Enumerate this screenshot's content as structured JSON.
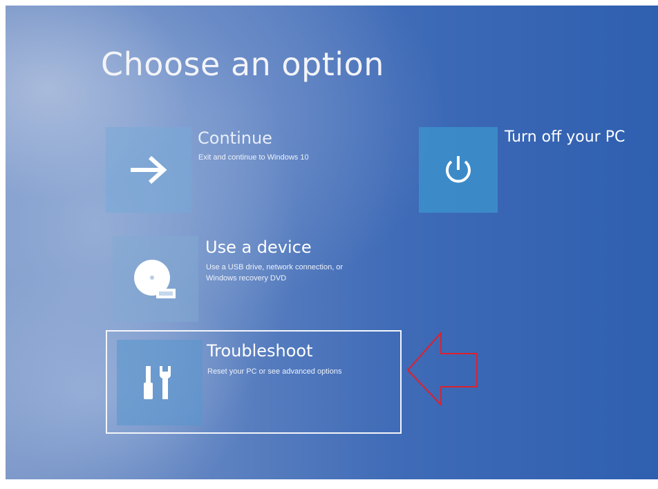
{
  "screen": {
    "title": "Choose an option"
  },
  "options": [
    {
      "id": "continue",
      "title": "Continue",
      "description": "Exit and continue to Windows 10",
      "icon": "arrow-right-icon"
    },
    {
      "id": "use-device",
      "title": "Use a device",
      "description": "Use a USB drive, network connection, or Windows recovery DVD",
      "icon": "disc-drive-icon"
    },
    {
      "id": "troubleshoot",
      "title": "Troubleshoot",
      "description": "Reset your PC or see advanced options",
      "icon": "tools-icon",
      "highlighted": true
    },
    {
      "id": "turn-off",
      "title": "Turn off your PC",
      "description": "",
      "icon": "power-icon"
    }
  ],
  "annotation": {
    "type": "arrow",
    "color": "#e0202a",
    "points_to": "troubleshoot"
  },
  "colors": {
    "background": "#3f6bb7",
    "tile": "#78aad7",
    "text": "#ffffff"
  }
}
